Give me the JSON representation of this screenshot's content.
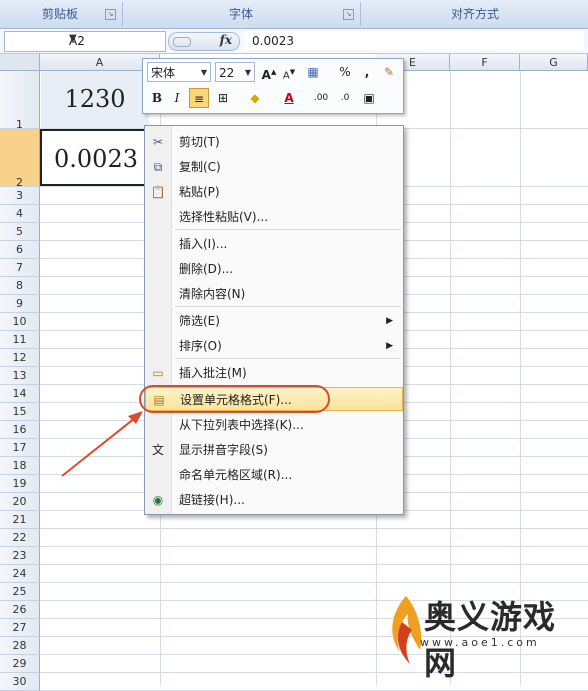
{
  "ribbon": {
    "groups": [
      {
        "label": "剪贴板"
      },
      {
        "label": "字体"
      },
      {
        "label": "对齐方式"
      }
    ]
  },
  "formula_bar": {
    "name_box": "A2",
    "fx_label": "fx",
    "value": "0.0023"
  },
  "grid": {
    "columns": [
      "A",
      "E",
      "F",
      "G"
    ],
    "rows": [
      "1",
      "2",
      "3",
      "4",
      "5",
      "6",
      "7",
      "8",
      "9",
      "10",
      "11",
      "12",
      "13",
      "14",
      "15",
      "16",
      "17",
      "18",
      "19",
      "20",
      "21",
      "22",
      "23",
      "24",
      "25",
      "26",
      "27",
      "28",
      "29",
      "30"
    ],
    "cells": {
      "A1": "1230",
      "A2": "0.0023"
    }
  },
  "mini_toolbar": {
    "font_name": "宋体",
    "font_size": "22",
    "percent": "%",
    "comma": ",",
    "bold": "B",
    "italic": "I"
  },
  "context_menu": {
    "items": [
      {
        "label": "剪切(T)",
        "icon": "scissors-icon"
      },
      {
        "label": "复制(C)",
        "icon": "copy-icon"
      },
      {
        "label": "粘贴(P)",
        "icon": "paste-icon"
      },
      {
        "label": "选择性粘贴(V)..."
      },
      {
        "label": "插入(I)..."
      },
      {
        "label": "删除(D)..."
      },
      {
        "label": "清除内容(N)"
      },
      {
        "label": "筛选(E)",
        "submenu": true
      },
      {
        "label": "排序(O)",
        "submenu": true
      },
      {
        "label": "插入批注(M)",
        "icon": "comment-icon"
      },
      {
        "label": "设置单元格格式(F)...",
        "icon": "format-cells-icon",
        "highlighted": true
      },
      {
        "label": "从下拉列表中选择(K)..."
      },
      {
        "label": "显示拼音字段(S)",
        "icon": "phonetic-icon"
      },
      {
        "label": "命名单元格区域(R)..."
      },
      {
        "label": "超链接(H)...",
        "icon": "hyperlink-icon"
      }
    ]
  },
  "watermark": {
    "title": "奥义游戏网",
    "url": "www.aoe1.com"
  },
  "colors": {
    "highlight": "#fde39a",
    "annotation": "#d94a33"
  }
}
